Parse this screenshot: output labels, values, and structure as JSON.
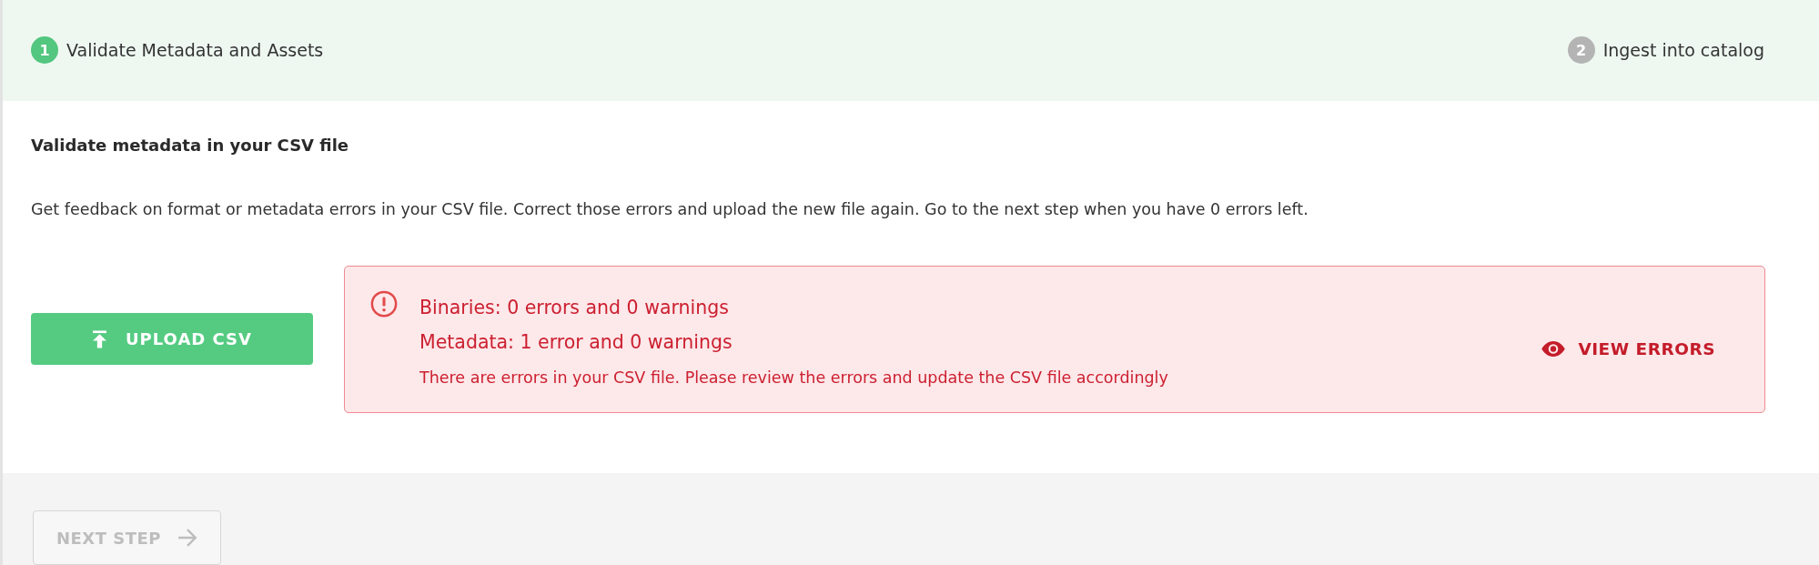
{
  "steps": [
    {
      "number": "1",
      "label": "Validate Metadata and Assets",
      "selected": true
    },
    {
      "number": "2",
      "label": "Ingest into catalog",
      "selected": false
    }
  ],
  "section": {
    "title": "Validate metadata in your CSV file",
    "description": "Get feedback on format or metadata errors in your CSV file. Correct those errors and upload the new file again. Go to the next step when you have 0 errors left."
  },
  "upload_button": {
    "label": "UPLOAD CSV"
  },
  "alert": {
    "lines": [
      "Binaries: 0 errors and 0 warnings",
      "Metadata: 1 error and 0 warnings"
    ],
    "message": "There are errors in your CSV file. Please review the errors and update the CSV file accordingly",
    "action": "VIEW ERRORS"
  },
  "next_button": {
    "label": "NEXT STEP",
    "disabled": true
  }
}
